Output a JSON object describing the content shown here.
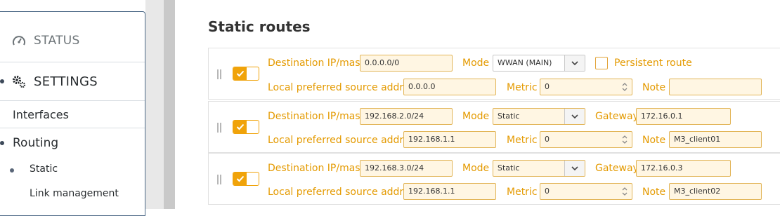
{
  "sidebar": {
    "status_label": "STATUS",
    "settings_label": "SETTINGS",
    "interfaces_label": "Interfaces",
    "routing_label": "Routing",
    "static_label": "Static",
    "link_management_label": "Link management"
  },
  "main": {
    "title": "Static routes",
    "labels": {
      "destination": "Destination IP/mask",
      "mode": "Mode",
      "gateway": "Gateway",
      "local_src": "Local preferred source address",
      "metric": "Metric",
      "note": "Note",
      "persistent": "Persistent route"
    },
    "routes": [
      {
        "enabled": true,
        "destination": "0.0.0.0/0",
        "mode": "WWAN (MAIN)",
        "local_src": "0.0.0.0",
        "metric": "0",
        "note": "",
        "persistent": false
      },
      {
        "enabled": true,
        "destination": "192.168.2.0/24",
        "mode": "Static",
        "gateway": "172.16.0.1",
        "local_src": "192.168.1.1",
        "metric": "0",
        "note": "M3_client01"
      },
      {
        "enabled": true,
        "destination": "192.168.3.0/24",
        "mode": "Static",
        "gateway": "172.16.0.3",
        "local_src": "192.168.1.1",
        "metric": "0",
        "note": "M3_client02"
      }
    ]
  },
  "colors": {
    "accent": "#f0a30a",
    "label": "#e49a00",
    "input_bg": "#fff6e3",
    "input_border": "#e2b558"
  }
}
